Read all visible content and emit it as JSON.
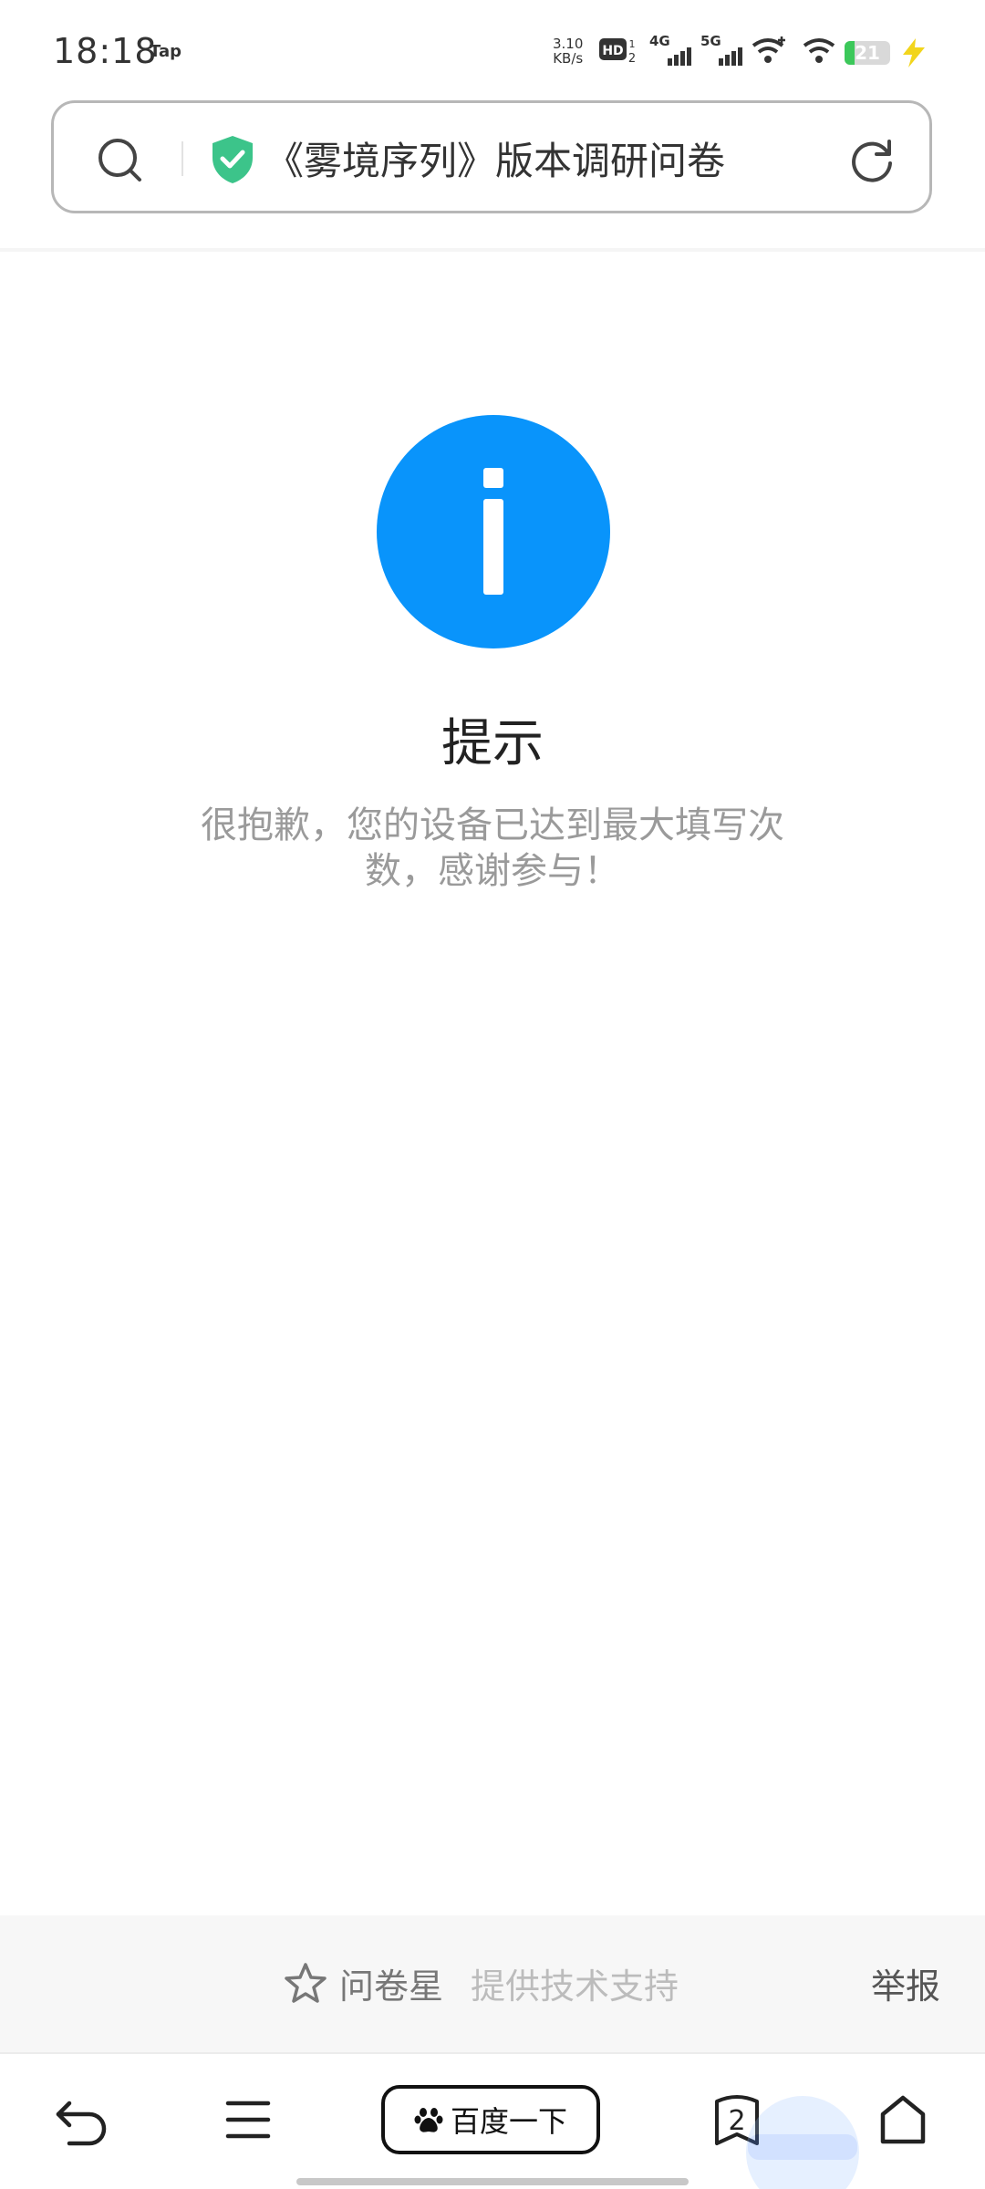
{
  "status_bar": {
    "time": "18:18",
    "app_tag": "Tap",
    "net_speed_value": "3.10",
    "net_speed_unit": "KB/s",
    "sim1_label": "4G",
    "sim2_label": "5G",
    "battery_level": "21",
    "battery_fraction": 0.21,
    "icons": [
      "hd-icon",
      "signal-4g-icon",
      "signal-5g-icon",
      "wifi-plus-icon",
      "wifi-icon",
      "battery-icon",
      "charging-bolt-icon"
    ]
  },
  "address_bar": {
    "page_title": "《雾境序列》版本调研问卷",
    "icons": [
      "search-icon",
      "shield-check-icon",
      "refresh-icon"
    ],
    "shield_color": "#3cc48a"
  },
  "notice": {
    "icon": "info-icon",
    "icon_color": "#0994fb",
    "title": "提示",
    "message": "很抱歉，您的设备已达到最大填写次数，感谢参与！"
  },
  "footer": {
    "brand": "问卷星",
    "support_text": "提供技术支持",
    "report_link": "举报",
    "icons": [
      "star-icon"
    ]
  },
  "bottom_nav": {
    "baidu_button": "百度一下",
    "tab_count": "2",
    "icons": [
      "back-icon",
      "menu-icon",
      "baidu-paw-icon",
      "tabs-icon",
      "home-icon"
    ]
  }
}
